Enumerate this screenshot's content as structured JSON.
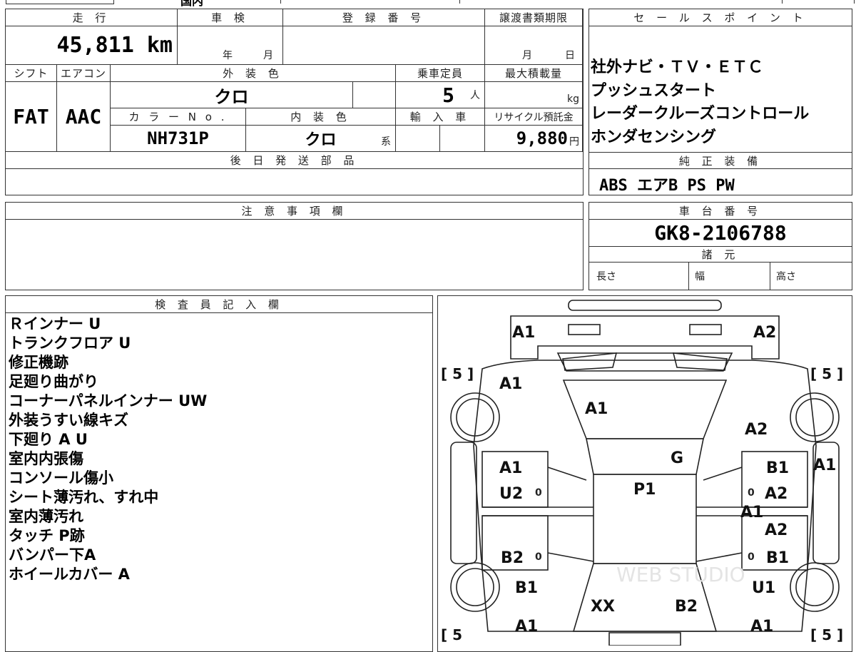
{
  "top_strip": {
    "partial_text": "国内"
  },
  "spec": {
    "h_mileage": "走 行",
    "h_shaken": "車 検",
    "h_reg_no": "登 録 番 号",
    "h_transfer": "譲渡書類期限",
    "mileage": "45,811 km",
    "shaken_year": "年",
    "shaken_month": "月",
    "transfer_month": "月",
    "transfer_day": "日",
    "h_shift": "シフト",
    "h_aircon": "エアコン",
    "h_ext_color": "外 装 色",
    "h_capacity": "乗車定員",
    "h_max_load": "最大積載量",
    "shift": "FAT",
    "aircon": "AAC",
    "ext_color": "クロ",
    "capacity": "5",
    "capacity_unit": "人",
    "load_unit": "kg",
    "h_color_no": "カ ラ ー N o .",
    "h_int_color": "内 装 色",
    "h_import": "輸 入 車",
    "h_recycle": "リサイクル預託金",
    "color_no": "NH731P",
    "int_color": "クロ",
    "int_suffix": "系",
    "recycle": "9,880",
    "recycle_unit": "円",
    "h_later_parts": "後 日 発 送 部 品"
  },
  "sales": {
    "header": "セ ー ル ス ポ イ ン ト",
    "points": [
      "社外ナビ・ＴＶ・ＥＴＣ",
      "プッシュスタート",
      "レーダークルーズコントロール",
      "ホンダセンシング"
    ]
  },
  "genuine": {
    "header": "純 正 装 備",
    "value": "ABS エアB PS PW"
  },
  "notes": {
    "header": "注 意 事 項 欄"
  },
  "chassis": {
    "header": "車 台 番 号",
    "value": "GK8-2106788"
  },
  "specs_dim": {
    "header": "諸 元",
    "length": "長さ",
    "width": "幅",
    "height": "高さ"
  },
  "inspector": {
    "header": "検 査 員 記 入 欄",
    "lines": [
      "Ｒインナー U",
      "トランクフロア U",
      "修正機跡",
      "足廻り曲がり",
      "コーナーパネルインナー UW",
      "外装うすい線キズ",
      "下廻り A U",
      "室内内張傷",
      "コンソール傷小",
      "シート薄汚れ、すれ中",
      "室内薄汚れ",
      "タッチ P跡",
      "バンパー下A",
      "ホイールカバー A"
    ]
  },
  "diagram": {
    "tire_left_top": "[ 5 ]",
    "tire_right_top": "[ 5 ]",
    "tire_left_bottom": "[ 5",
    "tire_right_bottom": "[ 5 ]",
    "marks": {
      "rear_left": "A1",
      "rear_right": "A2",
      "quarter_left": "A1",
      "rear_glass": "A1",
      "quarter_right": "A2",
      "roof_g": "G",
      "rear_door_left": "A1",
      "rear_door_left2": "U2",
      "rear_door_right": "B1",
      "side_right": "A1",
      "roof": "P1",
      "rear_door_right2": "A2",
      "sill_right": "A1",
      "front_door_right": "A2",
      "front_door_left": "B2",
      "front_door_right2": "B1",
      "fender_left": "B1",
      "fender_right": "U1",
      "windshield": "XX",
      "hood": "B2",
      "front_left": "A1",
      "front_right": "A1"
    },
    "watermark": "WEB STUDIO"
  }
}
